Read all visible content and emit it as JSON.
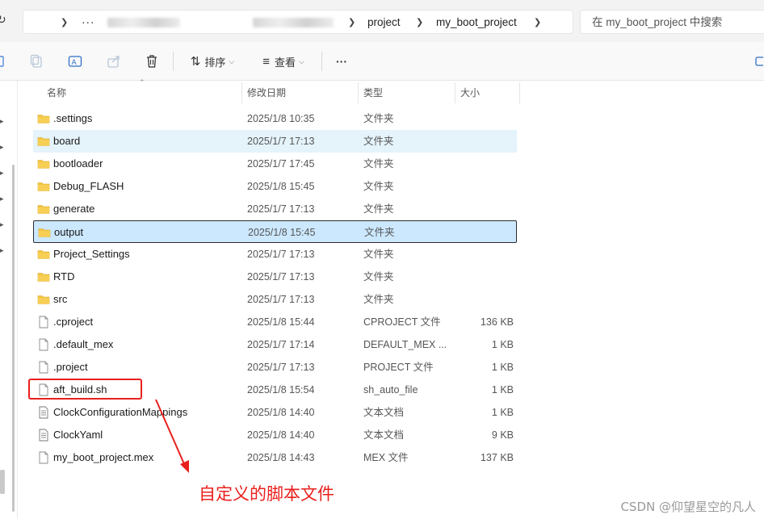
{
  "address": {
    "more": "···",
    "segments": [
      "project",
      "my_boot_project"
    ]
  },
  "search": {
    "placeholder": "在 my_boot_project 中搜索"
  },
  "toolbar": {
    "sort_label": "排序",
    "view_label": "查看",
    "more_label": "···"
  },
  "columns": {
    "name": "名称",
    "date": "修改日期",
    "type": "类型",
    "size": "大小"
  },
  "files": [
    {
      "name": ".settings",
      "date": "2025/1/8 10:35",
      "type": "文件夹",
      "size": "",
      "kind": "folder"
    },
    {
      "name": "board",
      "date": "2025/1/7 17:13",
      "type": "文件夹",
      "size": "",
      "kind": "folder"
    },
    {
      "name": "bootloader",
      "date": "2025/1/7 17:45",
      "type": "文件夹",
      "size": "",
      "kind": "folder"
    },
    {
      "name": "Debug_FLASH",
      "date": "2025/1/8 15:45",
      "type": "文件夹",
      "size": "",
      "kind": "folder"
    },
    {
      "name": "generate",
      "date": "2025/1/7 17:13",
      "type": "文件夹",
      "size": "",
      "kind": "folder"
    },
    {
      "name": "output",
      "date": "2025/1/8 15:45",
      "type": "文件夹",
      "size": "",
      "kind": "folder"
    },
    {
      "name": "Project_Settings",
      "date": "2025/1/7 17:13",
      "type": "文件夹",
      "size": "",
      "kind": "folder"
    },
    {
      "name": "RTD",
      "date": "2025/1/7 17:13",
      "type": "文件夹",
      "size": "",
      "kind": "folder"
    },
    {
      "name": "src",
      "date": "2025/1/7 17:13",
      "type": "文件夹",
      "size": "",
      "kind": "folder"
    },
    {
      "name": ".cproject",
      "date": "2025/1/8 15:44",
      "type": "CPROJECT 文件",
      "size": "136 KB",
      "kind": "file"
    },
    {
      "name": ".default_mex",
      "date": "2025/1/7 17:14",
      "type": "DEFAULT_MEX ...",
      "size": "1 KB",
      "kind": "file"
    },
    {
      "name": ".project",
      "date": "2025/1/7 17:13",
      "type": "PROJECT 文件",
      "size": "1 KB",
      "kind": "file"
    },
    {
      "name": "aft_build.sh",
      "date": "2025/1/8 15:54",
      "type": "sh_auto_file",
      "size": "1 KB",
      "kind": "file"
    },
    {
      "name": "ClockConfigurationMappings",
      "date": "2025/1/8 14:40",
      "type": "文本文档",
      "size": "1 KB",
      "kind": "text"
    },
    {
      "name": "ClockYaml",
      "date": "2025/1/8 14:40",
      "type": "文本文档",
      "size": "9 KB",
      "kind": "text"
    },
    {
      "name": "my_boot_project.mex",
      "date": "2025/1/8 14:43",
      "type": "MEX 文件",
      "size": "137 KB",
      "kind": "file"
    }
  ],
  "annotation": {
    "text": "自定义的脚本文件"
  },
  "watermark": "CSDN @仰望星空的凡人",
  "colors": {
    "folder": "#f4c542",
    "hover": "#e5f3fb",
    "selected": "#cce8ff",
    "annotation": "#e8201d"
  }
}
